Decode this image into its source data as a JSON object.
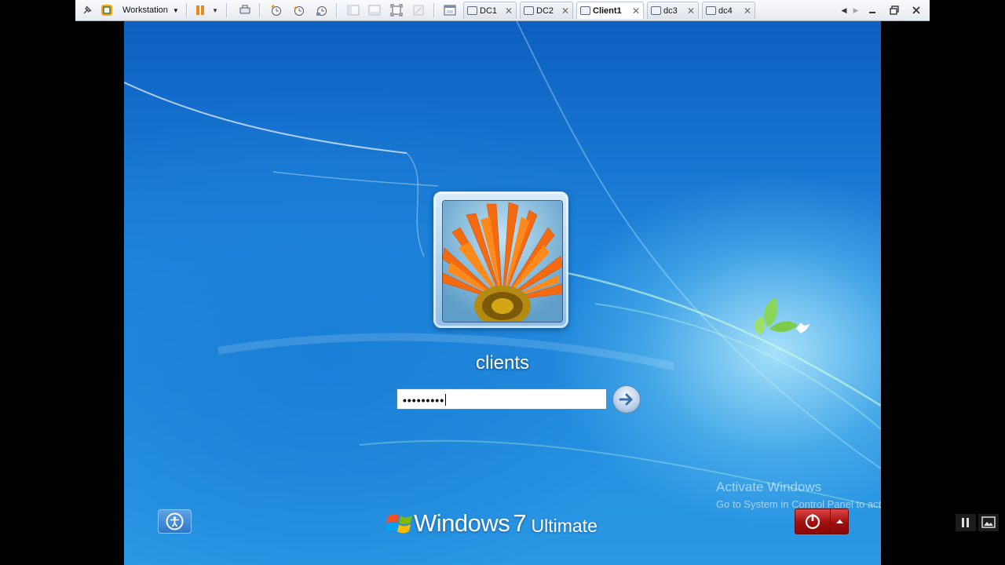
{
  "toolbar": {
    "menu_label": "Workstation",
    "tabs": [
      {
        "label": "DC1",
        "active": false
      },
      {
        "label": "DC2",
        "active": false
      },
      {
        "label": "Client1",
        "active": true
      },
      {
        "label": "dc3",
        "active": false
      },
      {
        "label": "dc4",
        "active": false
      }
    ],
    "close_glyph": "✕"
  },
  "logon": {
    "username": "clients",
    "password_mask": "•••••••••",
    "avatar": "orange-flower-picture"
  },
  "branding": {
    "product": "Windows",
    "version": "7",
    "edition": "Ultimate"
  },
  "watermark": {
    "title": "Activate Windows",
    "subtitle": "Go to System in Control Panel to activate Windows."
  },
  "colors": {
    "desktop_blue": "#1f86dc",
    "power_red": "#c21b1b",
    "pause_orange": "#e8891a"
  }
}
